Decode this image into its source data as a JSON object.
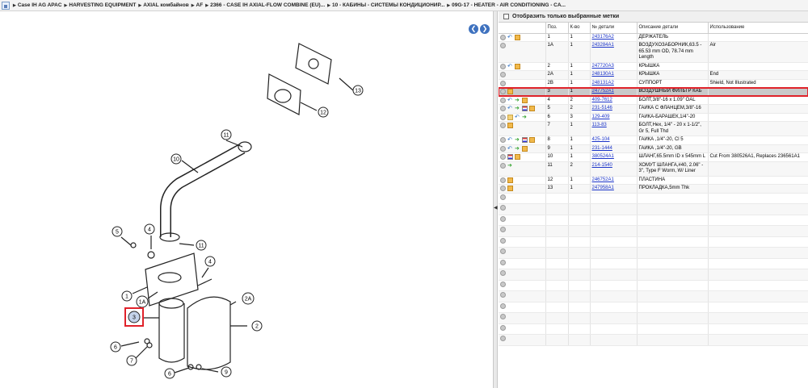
{
  "breadcrumb": [
    "Case IH AG APAC",
    "HARVESTING EQUIPMENT",
    "AXIAL комбайнов",
    "AF",
    "2366 - CASE IH AXIAL-FLOW COMBINE (EU)...",
    "10 - КАБИНЫ - СИСТЕМЫ КОНДИЦИОНИР...",
    "09G-17 - HEATER - AIR CONDITIONING - CA..."
  ],
  "filter": {
    "label": "Отобразить только выбранные метки"
  },
  "table": {
    "headers": [
      "",
      "Поз.",
      "К-во",
      "№ детали",
      "Описание детали",
      "Использование"
    ],
    "rows": [
      {
        "icons": [
          "circle",
          "arrow",
          "box"
        ],
        "pos": "1",
        "qty": "1",
        "part": "243176A2",
        "desc": "ДЕРЖАТЕЛЬ",
        "usage": ""
      },
      {
        "icons": [
          "circle"
        ],
        "pos": "1A",
        "qty": "1",
        "part": "243284A1",
        "desc": "ВОЗДУХОЗАБОРНИК,63.5 - 65.53 mm OD, 78.74 mm Length",
        "usage": "Air"
      },
      {
        "icons": [
          "circle",
          "arrow",
          "box"
        ],
        "pos": "2",
        "qty": "1",
        "part": "247720A3",
        "desc": "КРЫШКА",
        "usage": ""
      },
      {
        "icons": [
          "circle"
        ],
        "pos": "2A",
        "qty": "1",
        "part": "248130A1",
        "desc": "КРЫШКА",
        "usage": "End"
      },
      {
        "icons": [
          "circle"
        ],
        "pos": "2B",
        "qty": "1",
        "part": "248131A2",
        "desc": "СУППОРТ",
        "usage": "Shield, Not Illustrated"
      },
      {
        "icons": [
          "circle",
          "box"
        ],
        "pos": "3",
        "qty": "1",
        "part": "247752A1",
        "desc": "ВОЗДУШНЫЙ ФИЛЬТР КАБ",
        "usage": "",
        "selected": true
      },
      {
        "icons": [
          "circle",
          "arrow",
          "green",
          "box"
        ],
        "pos": "4",
        "qty": "2",
        "part": "409-7612",
        "desc": "БОЛТ,3/8\"-16 x 1.09\" OAL",
        "usage": ""
      },
      {
        "icons": [
          "circle",
          "arrow",
          "green",
          "flag",
          "box"
        ],
        "pos": "5",
        "qty": "2",
        "part": "231-5146",
        "desc": "ГАЙКА С ФЛАНЦЕМ,3/8\"-16",
        "usage": ""
      },
      {
        "icons": [
          "circle",
          "folder",
          "arrow",
          "green"
        ],
        "pos": "6",
        "qty": "3",
        "part": "129-409",
        "desc": "ГАЙКА-БАРАШЕК,1/4\"-20",
        "usage": ""
      },
      {
        "icons": [
          "circle",
          "box"
        ],
        "pos": "7",
        "qty": "1",
        "part": "113-83",
        "desc": "БОЛТ,Hex, 1/4\" - 20 x 1-1/2\", Gr 5, Full Thd",
        "usage": ""
      },
      {
        "icons": [
          "circle",
          "arrow",
          "green",
          "flag",
          "box"
        ],
        "pos": "8",
        "qty": "1",
        "part": "425-104",
        "desc": "ГАЙКА ,1/4\"-20, Cl 5",
        "usage": ""
      },
      {
        "icons": [
          "circle",
          "arrow",
          "green",
          "box"
        ],
        "pos": "9",
        "qty": "1",
        "part": "231-1444",
        "desc": "ГАЙКА ,1/4\"-20, GB",
        "usage": ""
      },
      {
        "icons": [
          "circle",
          "flag",
          "box"
        ],
        "pos": "10",
        "qty": "1",
        "part": "380524A1",
        "desc": "ШЛАНГ,65.5mm ID x 545mm L",
        "usage": "Cut From 380526A1, Replaces 236561A1"
      },
      {
        "icons": [
          "circle",
          "green"
        ],
        "pos": "11",
        "qty": "2",
        "part": "214-1540",
        "desc": "ХОМУТ ШЛАНГА,#40, 2.06\" - 3\", Type F Worm, W/ Liner",
        "usage": ""
      },
      {
        "icons": [
          "circle",
          "box"
        ],
        "pos": "12",
        "qty": "1",
        "part": "246752A1",
        "desc": "ПЛАСТИНА",
        "usage": ""
      },
      {
        "icons": [
          "circle",
          "box"
        ],
        "pos": "13",
        "qty": "1",
        "part": "247958A1",
        "desc": "ПРОКЛАДКА,5mm Thk",
        "usage": ""
      }
    ]
  },
  "diagram": {
    "callouts": [
      "1",
      "1A",
      "2",
      "2A",
      "3",
      "4",
      "5",
      "6",
      "7",
      "8",
      "6",
      "9",
      "10",
      "11",
      "11",
      "12",
      "13"
    ],
    "selected_callout": "3"
  },
  "nav": {
    "prev": "❮",
    "next": "❯"
  },
  "colors": {
    "accent": "#3f72bf",
    "highlight": "#e0222a",
    "link": "#1a33c8"
  }
}
